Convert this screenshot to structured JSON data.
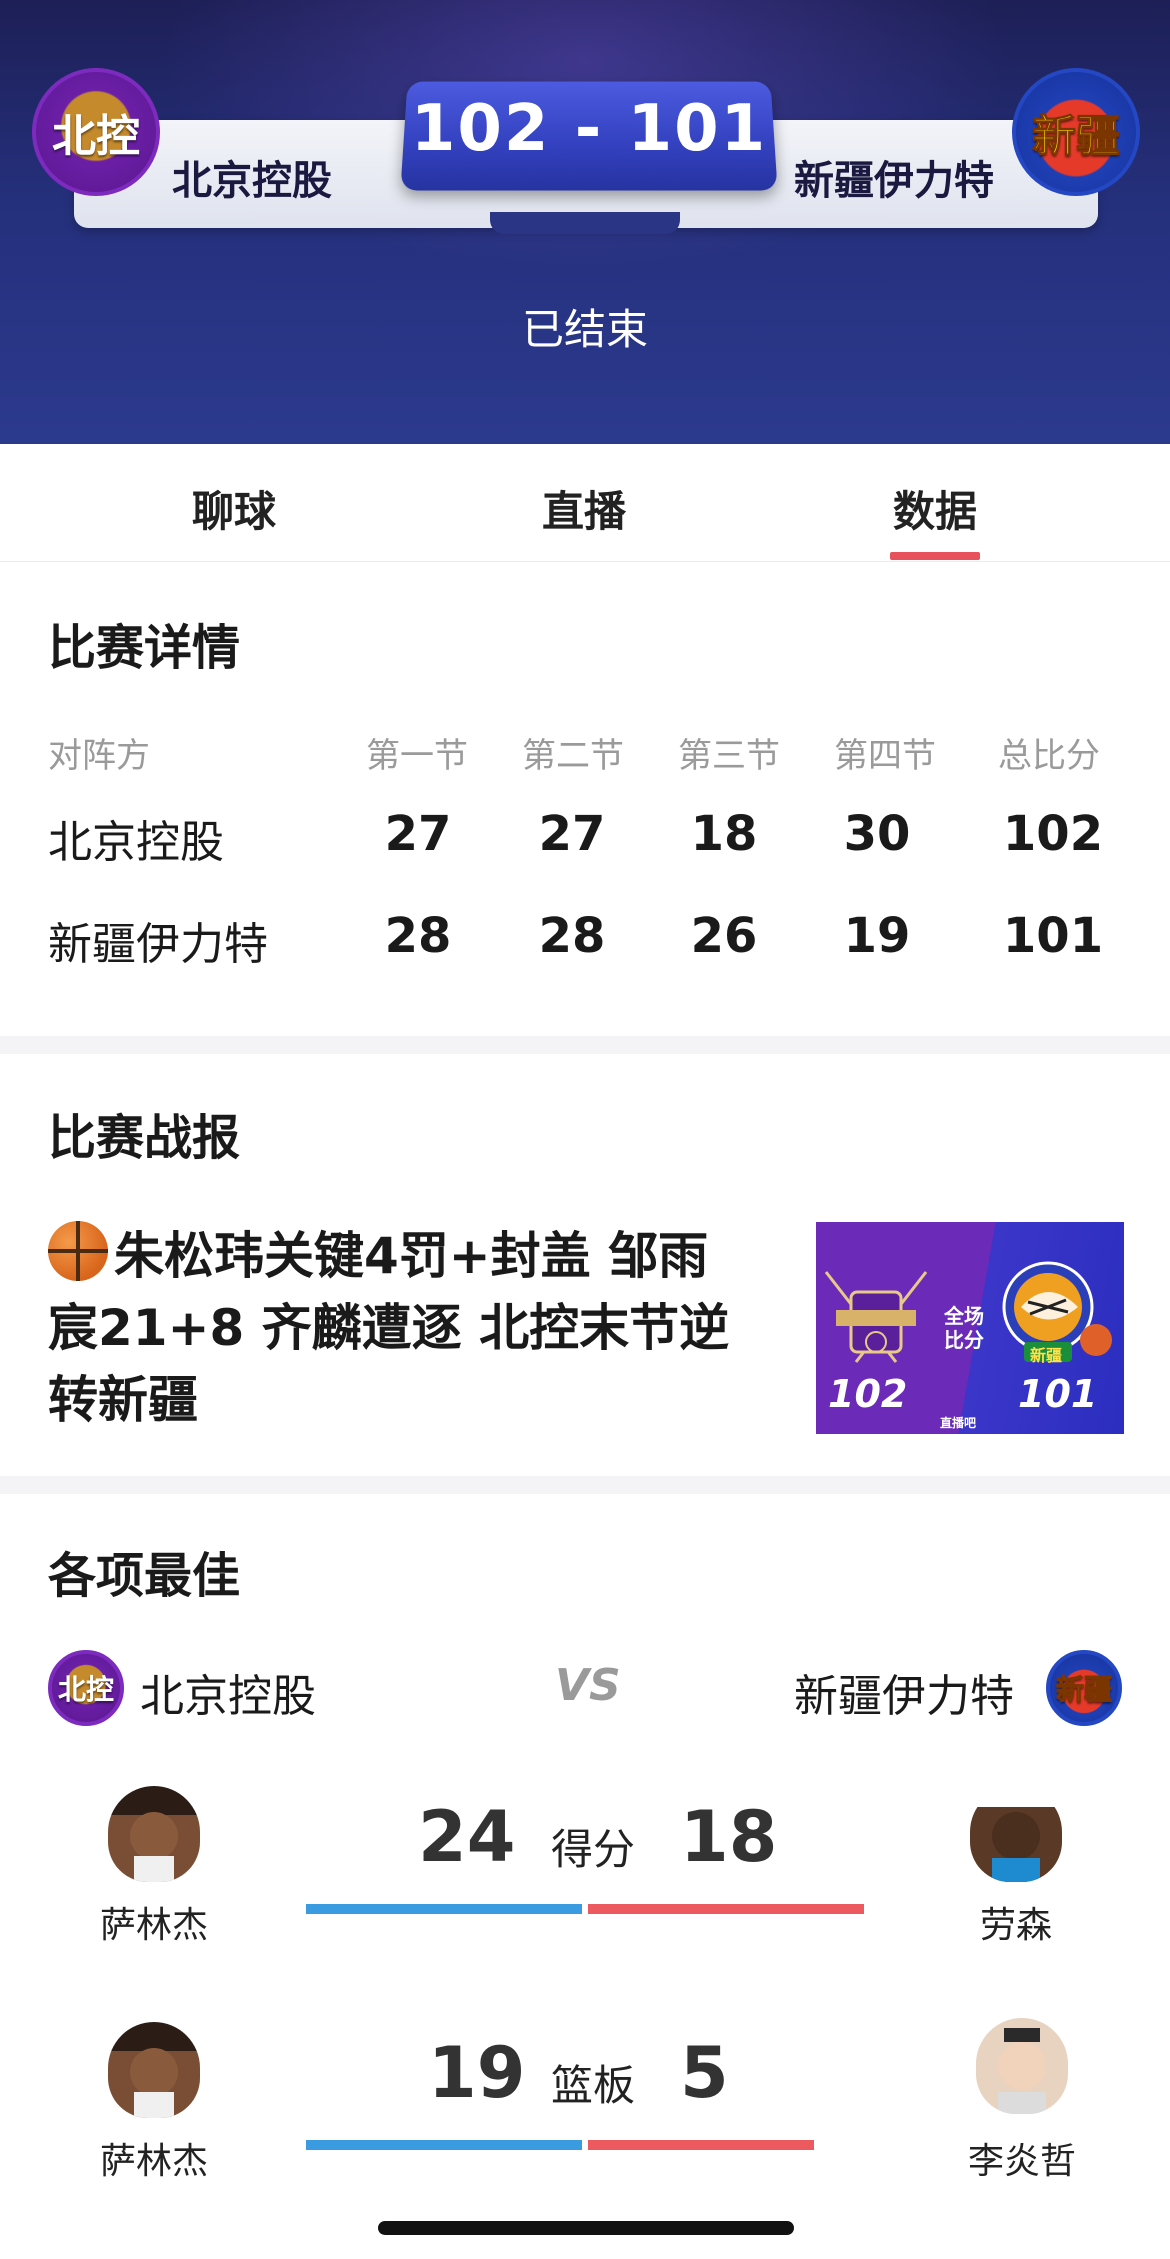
{
  "header": {
    "home_team": "北京控股",
    "away_team": "新疆伊力特",
    "home_logo_text": "北控",
    "away_logo_text": "新疆",
    "score": "102  -  101",
    "status": "已结束"
  },
  "tabs": [
    {
      "label": "聊球"
    },
    {
      "label": "直播"
    },
    {
      "label": "数据",
      "active": true
    }
  ],
  "match_detail": {
    "title": "比赛详情",
    "columns": [
      "对阵方",
      "第一节",
      "第二节",
      "第三节",
      "第四节",
      "总比分"
    ],
    "rows": [
      {
        "team": "北京控股",
        "scores": [
          "27",
          "27",
          "18",
          "30",
          "102"
        ]
      },
      {
        "team": "新疆伊力特",
        "scores": [
          "28",
          "28",
          "26",
          "19",
          "101"
        ]
      }
    ]
  },
  "recap": {
    "title": "比赛战报",
    "icon": "basketball-icon",
    "lines": [
      "朱松玮关键4罚+封盖 邹雨",
      "宸21+8 齐麟遭逐 北控末节逆",
      "转新疆"
    ],
    "thumbnail": {
      "left_score": "102",
      "right_score": "101",
      "caption_line1": "全场",
      "caption_line2": "比分",
      "xj_text": "新疆",
      "watermark": "直播吧"
    }
  },
  "leaders": {
    "title": "各项最佳",
    "home_team": "北京控股",
    "away_team": "新疆伊力特",
    "vs": "VS",
    "stats": [
      {
        "label": "得分",
        "home_player": "萨林杰",
        "home_value": "24",
        "away_player": "劳森",
        "away_value": "18",
        "home_share": 0.5,
        "away_share": 0.5
      },
      {
        "label": "篮板",
        "home_player": "萨林杰",
        "home_value": "19",
        "away_player": "李炎哲",
        "away_value": "5",
        "home_share": 0.5,
        "away_share": 0.41
      }
    ]
  },
  "colors": {
    "accent_red": "#e8505b",
    "bar_blue": "#3a9be0",
    "bar_red": "#ec5a5f",
    "header_navy": "#25307c"
  }
}
